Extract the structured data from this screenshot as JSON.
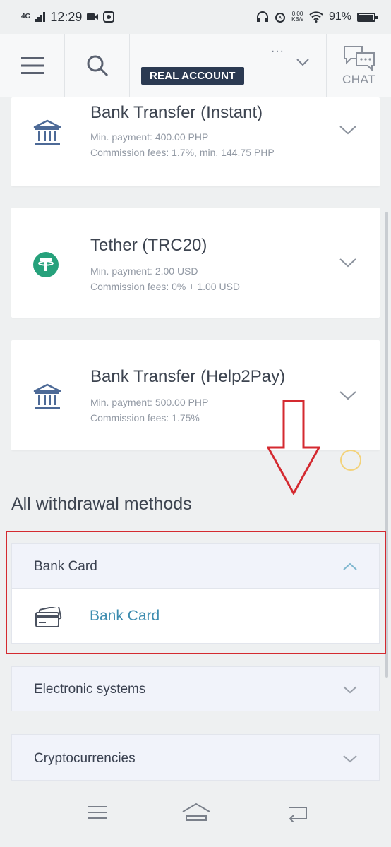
{
  "status_bar": {
    "network": "4G",
    "time": "12:29",
    "net_speed_value": "0.00",
    "net_speed_unit": "KB/s",
    "battery": "91%"
  },
  "header": {
    "account_badge": "REAL ACCOUNT",
    "account_more": "···",
    "chat_label": "CHAT"
  },
  "methods": [
    {
      "title": "Bank Transfer (Instant)",
      "min_payment": "Min. payment: 400.00 PHP",
      "commission": "Commission fees: 1.7%, min. 144.75 PHP",
      "icon": "bank-icon"
    },
    {
      "title": "Tether (TRC20)",
      "min_payment": "Min. payment: 2.00 USD",
      "commission": "Commission fees: 0% + 1.00 USD",
      "icon": "tether-icon"
    },
    {
      "title": "Bank Transfer (Help2Pay)",
      "min_payment": "Min. payment: 500.00 PHP",
      "commission": "Commission fees: 1.75%",
      "icon": "bank-icon"
    }
  ],
  "all_methods": {
    "title": "All withdrawal methods",
    "groups": [
      {
        "label": "Bank Card",
        "expanded": true,
        "items": [
          "Bank Card"
        ]
      },
      {
        "label": "Electronic systems",
        "expanded": false
      },
      {
        "label": "Cryptocurrencies",
        "expanded": false
      }
    ]
  },
  "colors": {
    "accent_link": "#3e8db0",
    "badge_bg": "#2b3a52",
    "tether_green": "#26a17b",
    "highlight_red": "#d42a30"
  }
}
